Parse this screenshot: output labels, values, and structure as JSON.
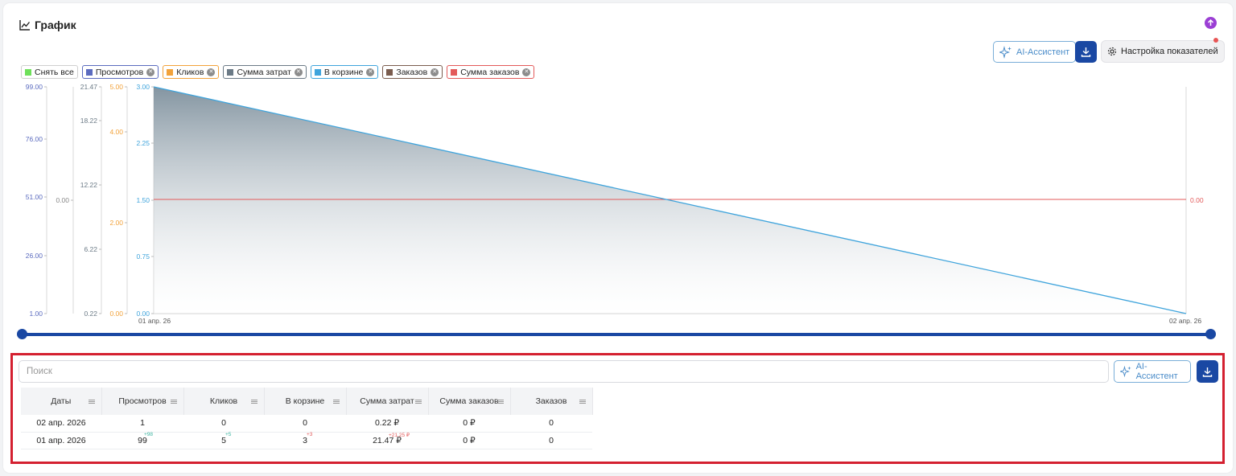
{
  "header": {
    "title": "График"
  },
  "toolbar": {
    "ai_label": "AI-Ассистент",
    "settings_label": "Настройка показателей"
  },
  "legend": [
    {
      "label": "Снять все",
      "color": "#6ee05a",
      "border": "#cfcfcf",
      "closable": false
    },
    {
      "label": "Просмотров",
      "color": "#5b6bbf",
      "border": "#5b6bbf",
      "closable": true
    },
    {
      "label": "Кликов",
      "color": "#f2a23a",
      "border": "#f2a23a",
      "closable": true
    },
    {
      "label": "Сумма затрат",
      "color": "#6b7a86",
      "border": "#6b7a86",
      "closable": true
    },
    {
      "label": "В корзине",
      "color": "#3fa4dc",
      "border": "#3fa4dc",
      "closable": true
    },
    {
      "label": "Заказов",
      "color": "#7a5c4e",
      "border": "#7a5c4e",
      "closable": true
    },
    {
      "label": "Сумма заказов",
      "color": "#e35a5a",
      "border": "#e35a5a",
      "closable": true
    }
  ],
  "chart_data": {
    "type": "area",
    "x": [
      "01 апр. 26",
      "02 апр. 26"
    ],
    "series": [
      {
        "name": "Просмотров",
        "values": [
          99,
          1
        ],
        "color": "#5b6bbf"
      },
      {
        "name": "Кликов",
        "values": [
          5,
          0
        ],
        "color": "#f2a23a"
      },
      {
        "name": "Сумма затрат",
        "values": [
          21.47,
          0.22
        ],
        "color": "#6b7a86"
      },
      {
        "name": "В корзине",
        "values": [
          3,
          0
        ],
        "color": "#3fa4dc"
      },
      {
        "name": "Заказов",
        "values": [
          0,
          0
        ],
        "color": "#7a5c4e"
      },
      {
        "name": "Сумма заказов",
        "values": [
          0,
          0
        ],
        "color": "#e35a5a"
      }
    ],
    "axes": [
      {
        "ticks": [
          "99.00",
          "76.00",
          "51.00",
          "26.00",
          "1.00"
        ],
        "color": "#5b6bbf"
      },
      {
        "ticks": [
          "0.00"
        ],
        "color": "#888888"
      },
      {
        "ticks": [
          "21.47",
          "18.22",
          "12.22",
          "6.22",
          "0.22"
        ],
        "color": "#6b7a86"
      },
      {
        "ticks": [
          "5.00",
          "4.00",
          "2.00",
          "0.00"
        ],
        "color": "#f2a23a"
      },
      {
        "ticks": [
          "3.00",
          "2.25",
          "1.50",
          "0.75",
          "0.00"
        ],
        "color": "#3fa4dc"
      }
    ],
    "right_axis": {
      "ticks": [
        "0.00"
      ],
      "color": "#e35a5a"
    },
    "xlim": [
      "01 апр. 26",
      "02 апр. 26"
    ],
    "legend_position": "top-left",
    "grid": false
  },
  "table": {
    "search_placeholder": "Поиск",
    "ai_label": "AI-Ассистент",
    "headers": [
      "Даты",
      "Просмотров",
      "Кликов",
      "В корзине",
      "Сумма затрат",
      "Сумма заказов",
      "Заказов"
    ],
    "rows": [
      {
        "cells": [
          "02 апр. 2026",
          "1",
          "0",
          "0",
          "0.22 ₽",
          "0 ₽",
          "0"
        ],
        "deltas": [
          "",
          "",
          "",
          "",
          "",
          "",
          ""
        ]
      },
      {
        "cells": [
          "01 апр. 2026",
          "99",
          "5",
          "3",
          "21.47 ₽",
          "0 ₽",
          "0"
        ],
        "deltas": [
          "",
          "+98",
          "+5",
          "+3",
          "+21.25 ₽",
          "",
          ""
        ]
      }
    ],
    "delta_colors": [
      "#222222",
      "#3cb4a0",
      "#3cb4a0",
      "#e35a5a",
      "#e35a5a",
      "#222222",
      "#222222"
    ]
  }
}
